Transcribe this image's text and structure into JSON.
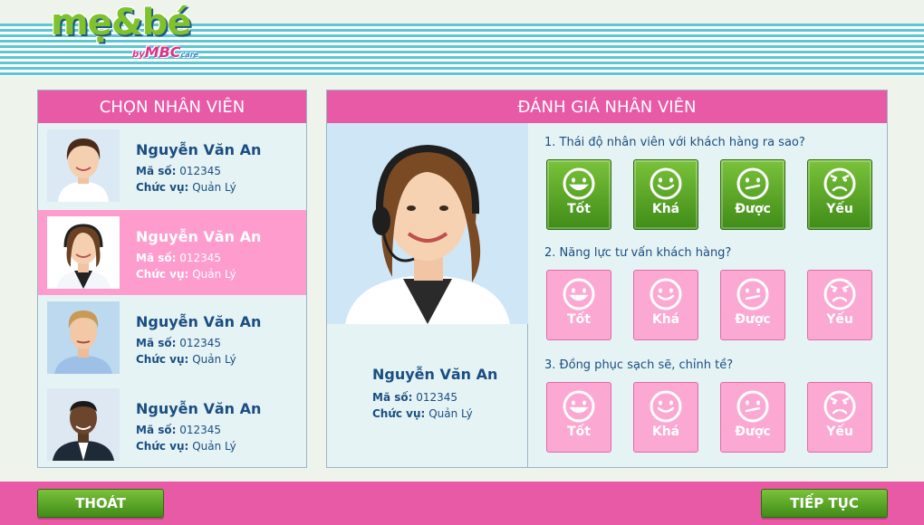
{
  "brand": {
    "name": "mẹ&bé",
    "by": "by",
    "sub": "MBC",
    "sub_suffix": "care"
  },
  "left_panel": {
    "title": "CHỌN NHÂN VIÊN",
    "employees": [
      {
        "name": "Nguyễn Văn An",
        "code_label": "Mã số:",
        "code": "012345",
        "role_label": "Chức vụ:",
        "role": "Quản Lý",
        "selected": false
      },
      {
        "name": "Nguyễn Văn An",
        "code_label": "Mã số:",
        "code": "012345",
        "role_label": "Chức vụ:",
        "role": "Quản Lý",
        "selected": true
      },
      {
        "name": "Nguyễn Văn An",
        "code_label": "Mã số:",
        "code": "012345",
        "role_label": "Chức vụ:",
        "role": "Quản Lý",
        "selected": false
      },
      {
        "name": "Nguyễn Văn An",
        "code_label": "Mã số:",
        "code": "012345",
        "role_label": "Chức vụ:",
        "role": "Quản Lý",
        "selected": false
      }
    ]
  },
  "right_panel": {
    "title": "ĐÁNH GIÁ NHÂN VIÊN",
    "employee": {
      "name": "Nguyễn Văn An",
      "code_label": "Mã số:",
      "code": "012345",
      "role_label": "Chức vụ:",
      "role": "Quản Lý"
    },
    "questions": [
      {
        "text": "1. Thái độ nhân viên với khách hàng ra sao?",
        "active": true
      },
      {
        "text": "2. Năng lực tư vấn khách hàng?",
        "active": false
      },
      {
        "text": "3. Đồng phục sạch sẽ, chỉnh tề?",
        "active": false
      }
    ],
    "ratings": [
      {
        "label": "Tốt",
        "icon": "very-happy-face-icon"
      },
      {
        "label": "Khá",
        "icon": "smile-face-icon"
      },
      {
        "label": "Được",
        "icon": "neutral-face-icon"
      },
      {
        "label": "Yếu",
        "icon": "angry-face-icon"
      }
    ]
  },
  "footer": {
    "exit_label": "THOÁT",
    "continue_label": "TIẾP TỤC"
  },
  "colors": {
    "pink": "#e85aa6",
    "light_pink": "#ff9cce",
    "green": "#5aa82a",
    "navy_text": "#1a4e82",
    "teal_stripe": "#5cc6d2"
  }
}
